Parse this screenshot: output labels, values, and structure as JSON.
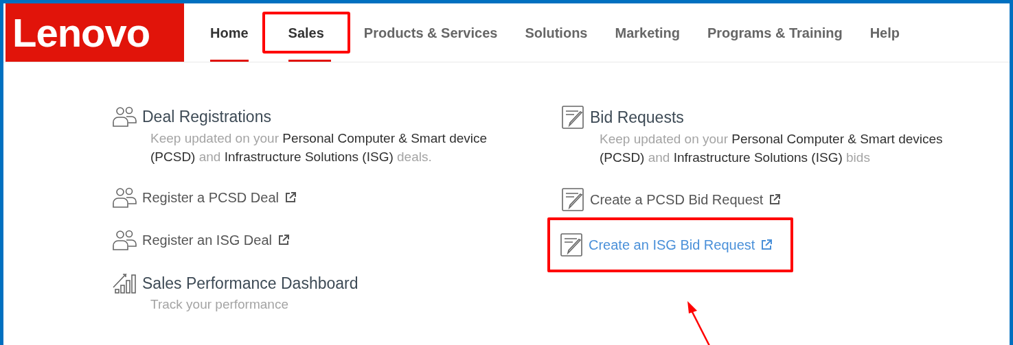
{
  "logo": {
    "text": "Lenovo"
  },
  "nav": [
    {
      "label": "Home",
      "underlined": true,
      "highlighted": false,
      "current": true
    },
    {
      "label": "Sales",
      "underlined": true,
      "highlighted": true,
      "current": true
    },
    {
      "label": "Products & Services",
      "underlined": false,
      "highlighted": false,
      "current": false
    },
    {
      "label": "Solutions",
      "underlined": false,
      "highlighted": false,
      "current": false
    },
    {
      "label": "Marketing",
      "underlined": false,
      "highlighted": false,
      "current": false
    },
    {
      "label": "Programs & Training",
      "underlined": false,
      "highlighted": false,
      "current": false
    },
    {
      "label": "Help",
      "underlined": false,
      "highlighted": false,
      "current": false
    }
  ],
  "columns": [
    {
      "items": [
        {
          "kind": "heading",
          "title": "Deal Registrations",
          "description": "Keep updated on your **Personal Computer & Smart device (PCSD)** and **Infrastructure Solutions (ISG)** deals."
        },
        {
          "kind": "link",
          "label": "Register a PCSD Deal",
          "hovered": false,
          "highlighted": false
        },
        {
          "kind": "link",
          "label": "Register an ISG Deal",
          "hovered": false,
          "highlighted": false
        },
        {
          "kind": "heading",
          "title": "Sales Performance Dashboard",
          "description": "Track your performance"
        }
      ]
    },
    {
      "items": [
        {
          "kind": "heading",
          "title": "Bid Requests",
          "description": "Keep updated on your **Personal Computer & Smart devices (PCSD)** and **Infrastructure Solutions (ISG)** bids"
        },
        {
          "kind": "link",
          "label": "Create a PCSD Bid Request",
          "hovered": false,
          "highlighted": false
        },
        {
          "kind": "link",
          "label": "Create an ISG Bid Request",
          "hovered": true,
          "highlighted": true
        }
      ]
    }
  ],
  "annotation": {
    "arrow": true
  }
}
